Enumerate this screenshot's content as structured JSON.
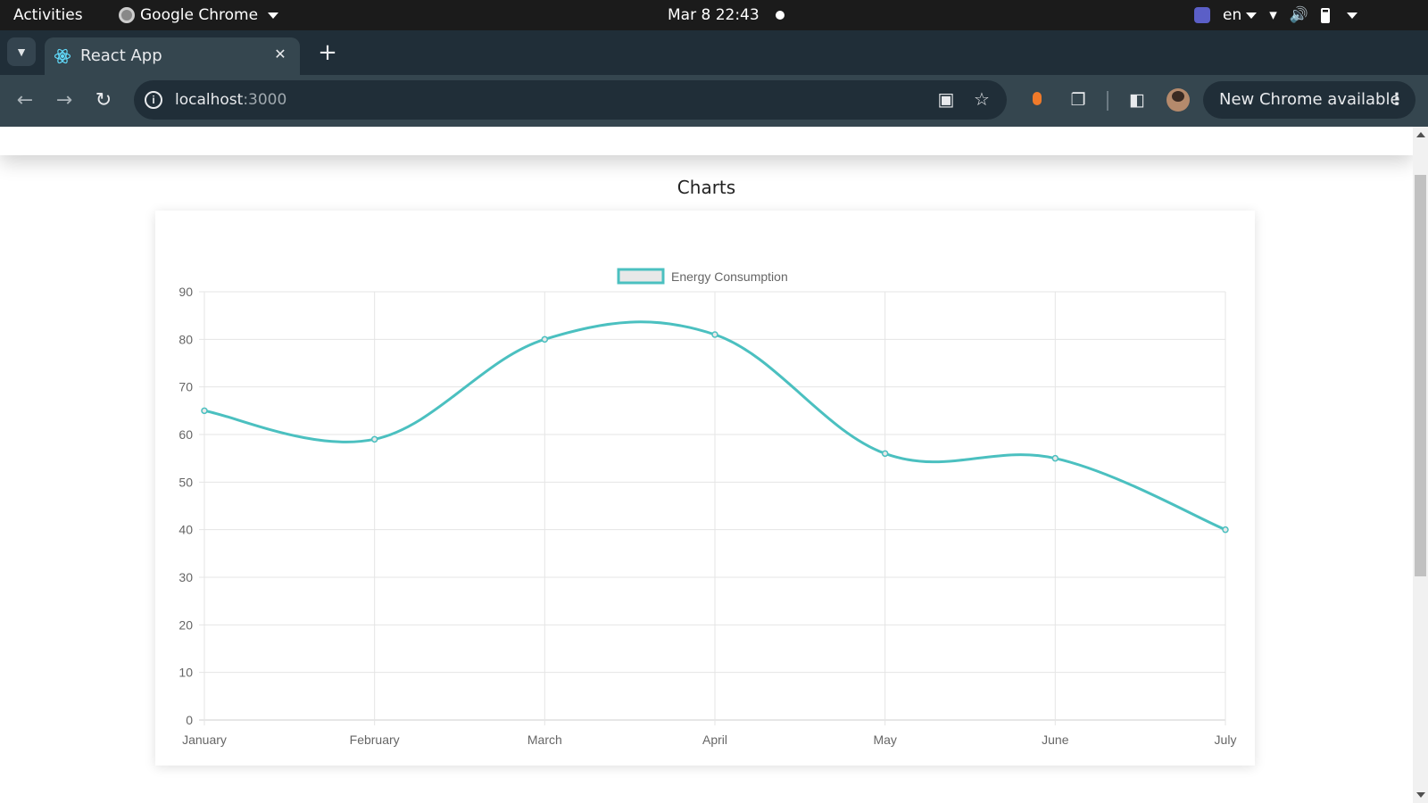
{
  "system_bar": {
    "activities": "Activities",
    "app_name": "Google Chrome",
    "clock": "Mar 8  22:43",
    "language": "en"
  },
  "browser": {
    "tab_title": "React App",
    "url_host": "localhost",
    "url_port": ":3000",
    "update_label": "New Chrome available"
  },
  "page": {
    "heading": "Charts"
  },
  "colors": {
    "series_line": "#4bc0c0",
    "legend_fill": "#e8e8e8",
    "grid": "#e5e5e5",
    "tick_text": "#666666"
  },
  "chart_data": {
    "type": "line",
    "categories": [
      "January",
      "February",
      "March",
      "April",
      "May",
      "June",
      "July"
    ],
    "series": [
      {
        "name": "Energy Consumption",
        "values": [
          65,
          59,
          80,
          81,
          56,
          55,
          40
        ]
      }
    ],
    "ylim": [
      0,
      90
    ],
    "yticks": [
      0,
      10,
      20,
      30,
      40,
      50,
      60,
      70,
      80,
      90
    ],
    "grid": true,
    "legend_position": "top-center",
    "smoothing": true
  }
}
